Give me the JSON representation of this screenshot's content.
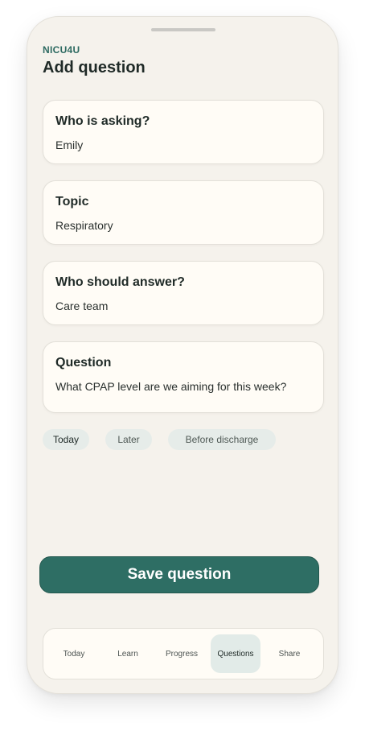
{
  "header": {
    "brand": "NICU4U",
    "title": "Add question"
  },
  "form": {
    "fields": [
      {
        "label": "Who is asking?",
        "value": "Emily"
      },
      {
        "label": "Topic",
        "value": "Respiratory"
      },
      {
        "label": "Who should answer?",
        "value": "Care team"
      },
      {
        "label": "Question",
        "value": "What CPAP level are we aiming for this week?"
      }
    ],
    "timing_chips": [
      {
        "label": "Today",
        "selected": true
      },
      {
        "label": "Later",
        "selected": false
      },
      {
        "label": "Before discharge",
        "selected": false
      }
    ],
    "save_label": "Save question"
  },
  "nav": {
    "items": [
      {
        "label": "Today"
      },
      {
        "label": "Learn"
      },
      {
        "label": "Progress"
      },
      {
        "label": "Questions",
        "active": true
      },
      {
        "label": "Share"
      }
    ]
  },
  "colors": {
    "accent": "#2e6e64",
    "background": "#f5f2ec",
    "card": "#fffcf6",
    "chip": "#e6ece9"
  }
}
